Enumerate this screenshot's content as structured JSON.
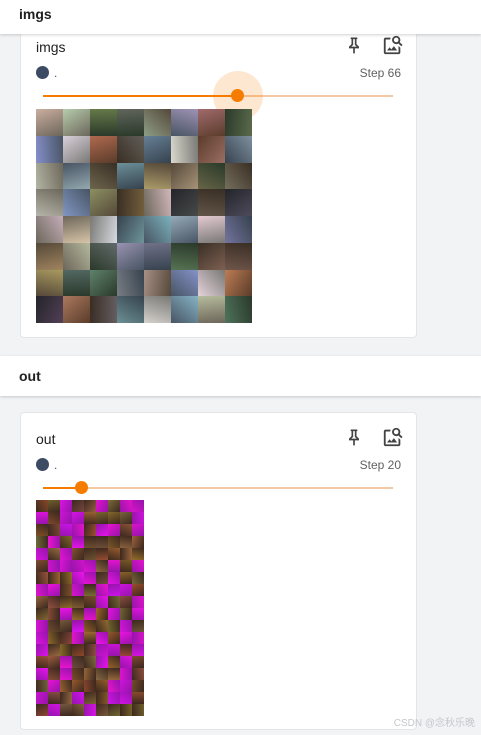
{
  "sections": [
    {
      "header": "imgs",
      "card": {
        "title": "imgs",
        "run_label": ".",
        "step_label": "Step 66",
        "slider_fraction": 0.556,
        "run_color": "#3c4a63",
        "accent_color": "#f57c00",
        "icons": [
          "pin-icon",
          "image-search-icon"
        ]
      }
    },
    {
      "header": "out",
      "card": {
        "title": "out",
        "run_label": ".",
        "step_label": "Step 20",
        "slider_fraction": 0.11,
        "run_color": "#3c4a63",
        "accent_color": "#f57c00",
        "icons": [
          "pin-icon",
          "image-search-icon"
        ]
      }
    }
  ],
  "watermark": "CSDN @念秋乐晚"
}
